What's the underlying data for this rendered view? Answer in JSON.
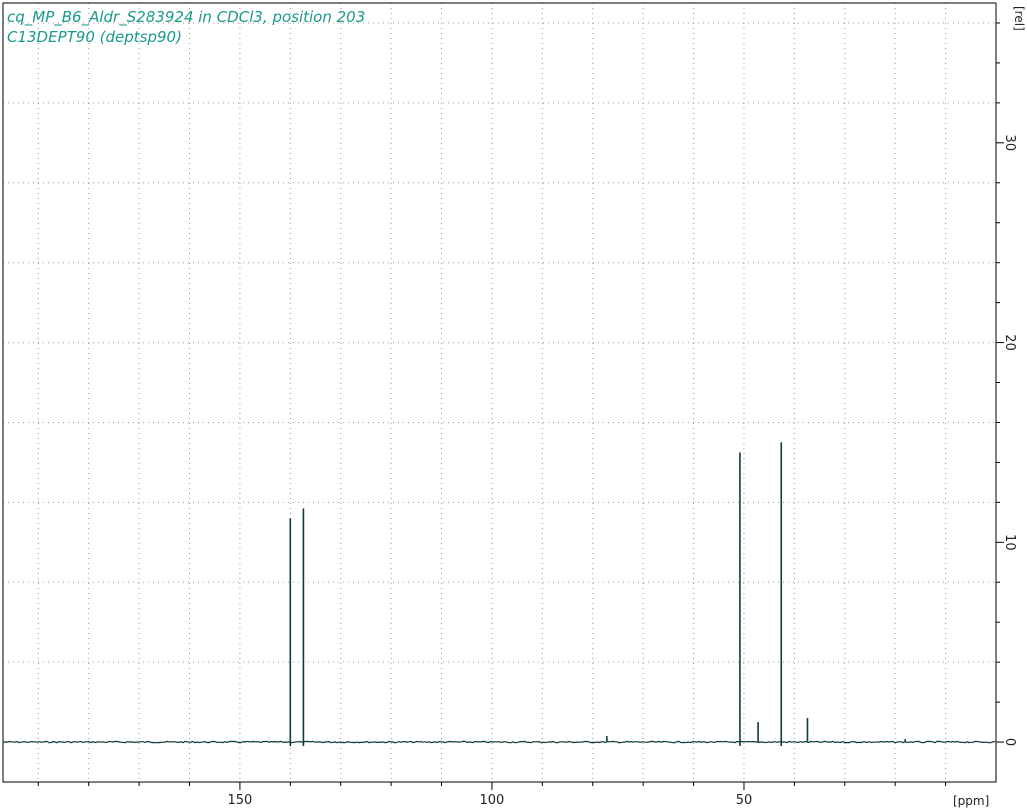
{
  "chart_data": {
    "type": "line",
    "title": "cq_MP_B6_Aldr_S283924 in CDCl3, position 203",
    "subtitle": "C13DEPT90 (deptsp90)",
    "xlabel": "[ppm]",
    "ylabel": "[rel]",
    "xlim": [
      197,
      0
    ],
    "ylim": [
      -2,
      37
    ],
    "x_ticks": [
      150,
      100,
      50
    ],
    "y_ticks": [
      0,
      10,
      20,
      30
    ],
    "grid": true,
    "reversed_x": true,
    "peaks": [
      {
        "x": 140.0,
        "y": 11.2
      },
      {
        "x": 137.4,
        "y": 11.7
      },
      {
        "x": 77.2,
        "y": 0.3
      },
      {
        "x": 50.8,
        "y": 14.5
      },
      {
        "x": 47.2,
        "y": 1.0
      },
      {
        "x": 42.6,
        "y": 15.0
      },
      {
        "x": 37.4,
        "y": 1.2
      },
      {
        "x": 18.0,
        "y": 0.15
      }
    ]
  }
}
